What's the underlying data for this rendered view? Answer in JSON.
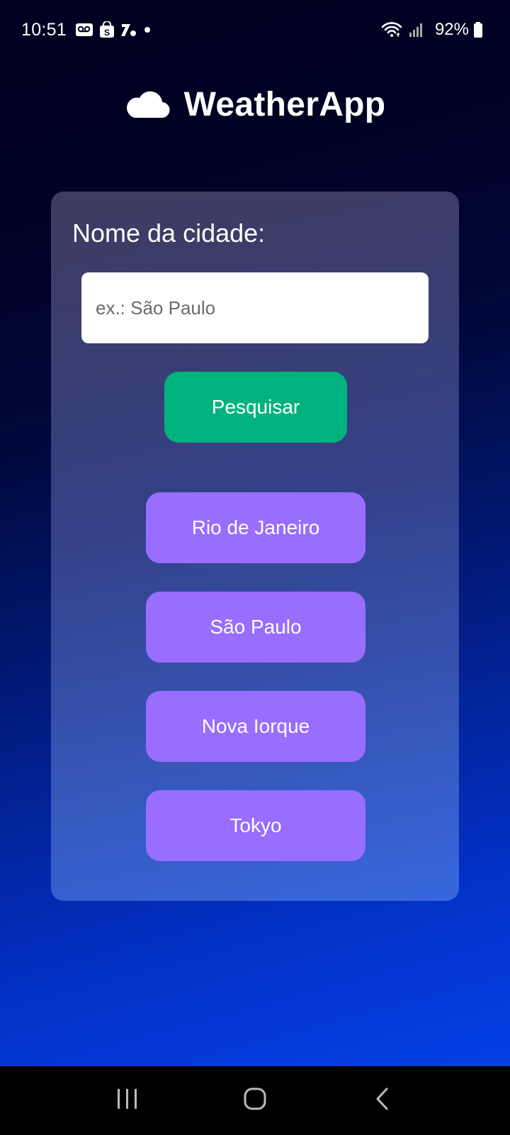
{
  "status_bar": {
    "time": "10:51",
    "battery_percent": "92%",
    "left_icons": [
      "voicemail-icon",
      "shopping-bag-icon",
      "app-notification-icon",
      "dot-icon"
    ],
    "right_icons": [
      "wifi-icon",
      "signal-icon",
      "battery-icon"
    ]
  },
  "header": {
    "title": "WeatherApp",
    "icon": "cloud-icon"
  },
  "search": {
    "label": "Nome da cidade:",
    "placeholder": "ex.: São Paulo",
    "value": "",
    "button_label": "Pesquisar"
  },
  "quick_cities": [
    {
      "label": "Rio de Janeiro"
    },
    {
      "label": "São Paulo"
    },
    {
      "label": "Nova Iorque"
    },
    {
      "label": "Tokyo"
    }
  ],
  "navigation": {
    "buttons": [
      "recent-apps-icon",
      "home-icon",
      "back-icon"
    ]
  },
  "colors": {
    "search_button": "#00b37e",
    "city_button": "#996dff",
    "background_top": "#00001f",
    "background_bottom": "#0445f2"
  }
}
